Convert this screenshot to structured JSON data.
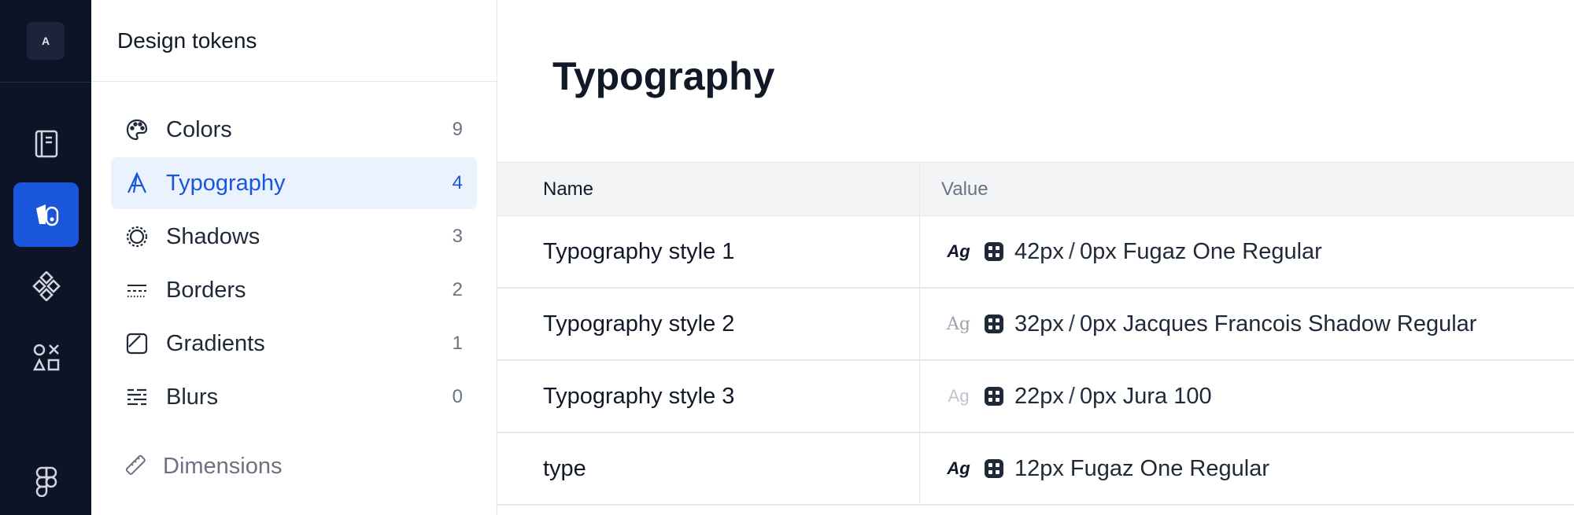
{
  "rail": {
    "logo_letter": "A",
    "items": [
      {
        "icon": "book-icon"
      },
      {
        "icon": "design-tokens-icon",
        "active": true
      },
      {
        "icon": "components-icon"
      },
      {
        "icon": "shapes-icon"
      },
      {
        "icon": "figma-icon"
      }
    ]
  },
  "sidebar": {
    "title": "Design tokens",
    "items": [
      {
        "label": "Colors",
        "count": "9",
        "icon": "palette-icon"
      },
      {
        "label": "Typography",
        "count": "4",
        "icon": "typography-icon",
        "active": true
      },
      {
        "label": "Shadows",
        "count": "3",
        "icon": "shadow-icon"
      },
      {
        "label": "Borders",
        "count": "2",
        "icon": "borders-icon"
      },
      {
        "label": "Gradients",
        "count": "1",
        "icon": "gradient-icon"
      },
      {
        "label": "Blurs",
        "count": "0",
        "icon": "blur-icon"
      }
    ],
    "dimensions_label": "Dimensions"
  },
  "main": {
    "title": "Typography",
    "columns": {
      "name": "Name",
      "value": "Value"
    },
    "rows": [
      {
        "name": "Typography style 1",
        "preview": "Ag",
        "size": "42px",
        "sep": "/",
        "line": "0px",
        "font": "Fugaz One Regular"
      },
      {
        "name": "Typography style 2",
        "preview": "Ag",
        "size": "32px",
        "sep": "/",
        "line": "0px",
        "font": "Jacques Francois Shadow Regular"
      },
      {
        "name": "Typography style 3",
        "preview": "Ag",
        "size": "22px",
        "sep": "/",
        "line": "0px",
        "font": "Jura 100"
      },
      {
        "name": "type",
        "preview": "Ag",
        "size": "12px",
        "font": "Fugaz One Regular"
      }
    ]
  },
  "colors": {
    "accent": "#1a56db",
    "rail_bg": "#0d1428",
    "active_bg": "#eaf2fd"
  }
}
